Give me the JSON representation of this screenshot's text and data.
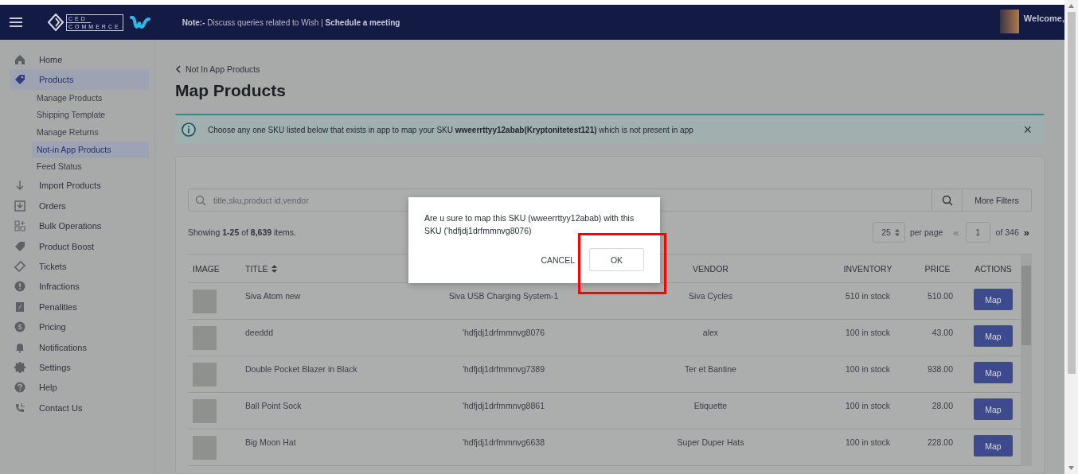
{
  "header": {
    "logo_top": "CED",
    "logo_bottom": "COMMERCE",
    "note": "**Note:-** Discuss queries related to Wish | **Schedule a meeting**",
    "welcome": "Welcome,"
  },
  "sidebar": {
    "items": [
      {
        "label": "Home",
        "selected": false
      },
      {
        "label": "Products",
        "selected": true,
        "children": [
          {
            "label": "Manage Products",
            "selected": false
          },
          {
            "label": "Shipping Template",
            "selected": false
          },
          {
            "label": "Manage Returns",
            "selected": false
          },
          {
            "label": "Not-in App Products",
            "selected": true
          },
          {
            "label": "Feed Status",
            "selected": false
          }
        ]
      },
      {
        "label": "Import Products",
        "selected": false
      },
      {
        "label": "Orders",
        "selected": false
      },
      {
        "label": "Bulk Operations",
        "selected": false
      },
      {
        "label": "Product Boost",
        "selected": false
      },
      {
        "label": "Tickets",
        "selected": false
      },
      {
        "label": "Infractions",
        "selected": false
      },
      {
        "label": "Penalities",
        "selected": false
      },
      {
        "label": "Pricing",
        "selected": false
      },
      {
        "label": "Notifications",
        "selected": false
      },
      {
        "label": "Settings",
        "selected": false
      },
      {
        "label": "Help",
        "selected": false
      },
      {
        "label": "Contact Us",
        "selected": false
      }
    ]
  },
  "breadcrumb": "Not In App Products",
  "title": "Map Products",
  "banner": {
    "text": "Choose any one SKU listed below that exists in app to map your SKU **wweerrttyy12abab(Kryptonitetest121)** which is not present in app",
    "close": "×"
  },
  "search": {
    "placeholder": "title,sku,product id,vendor",
    "more_filters": "More Filters"
  },
  "summary": "Showing **1-25** of **8,639** items.",
  "pagination": {
    "per_page_value": "25",
    "per_page_label": "per page",
    "prev": "«",
    "page": "1",
    "of": "of 346",
    "next": "»"
  },
  "table": {
    "columns": [
      {
        "label": "IMAGE",
        "sortable": false
      },
      {
        "label": "TITLE",
        "sortable": true
      },
      {
        "label": "VENDOR",
        "sortable": false
      },
      {
        "label": "INVENTORY",
        "sortable": false
      },
      {
        "label": "PRICE",
        "sortable": false
      },
      {
        "label": "ACTIONS",
        "sortable": false
      }
    ],
    "rows": [
      {
        "title": "Siva Atom new",
        "column_3": "Siva USB Charging System-1",
        "vendor": "Siva Cycles",
        "inventory": "510 in stock",
        "price": "510.00",
        "action": "Map"
      },
      {
        "title": "deeddd",
        "column_3": "'hdfjdj1drfmmnvg8076",
        "vendor": "alex",
        "inventory": "100 in stock",
        "price": "43.00",
        "action": "Map"
      },
      {
        "title": "Double Pocket Blazer in Black",
        "column_3": "'hdfjdj1drfmmnvg7389",
        "vendor": "Ter et Bantine",
        "inventory": "100 in stock",
        "price": "938.00",
        "action": "Map"
      },
      {
        "title": "Ball Point Sock",
        "column_3": "'hdfjdj1drfmmnvg8861",
        "vendor": "Etiquette",
        "inventory": "100 in stock",
        "price": "28.00",
        "action": "Map"
      },
      {
        "title": "Big Moon Hat",
        "column_3": "'hdfjdj1drfmmnvg6638",
        "vendor": "Super Duper Hats",
        "inventory": "100 in stock",
        "price": "228.00",
        "action": "Map"
      }
    ]
  },
  "dialog": {
    "message": "Are u sure to map this SKU (wweerrttyy12abab) with this SKU ('hdfjdj1drfmmnvg8076)",
    "cancel": "CANCEL",
    "ok": "OK",
    "ok_highlighted": true
  }
}
